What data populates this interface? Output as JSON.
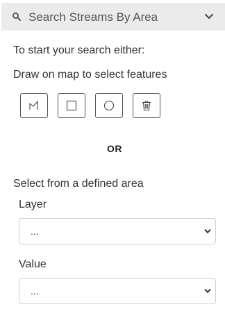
{
  "header": {
    "title": "Search Streams By Area",
    "left_icon": "search-icon",
    "right_icon": "chevron-down-icon"
  },
  "instructions": {
    "intro": "To start your search either:",
    "draw": "Draw on map to select features",
    "or": "OR",
    "select_area": "Select from a defined area"
  },
  "draw_tools": [
    {
      "icon": "polygon-icon"
    },
    {
      "icon": "rectangle-icon"
    },
    {
      "icon": "circle-icon"
    },
    {
      "icon": "trash-icon"
    }
  ],
  "layer_field": {
    "label": "Layer",
    "selected": "..."
  },
  "value_field": {
    "label": "Value",
    "selected": "..."
  },
  "colors": {
    "header_bg": "#ebebeb",
    "text": "#333333",
    "border": "#cfcfcf"
  }
}
